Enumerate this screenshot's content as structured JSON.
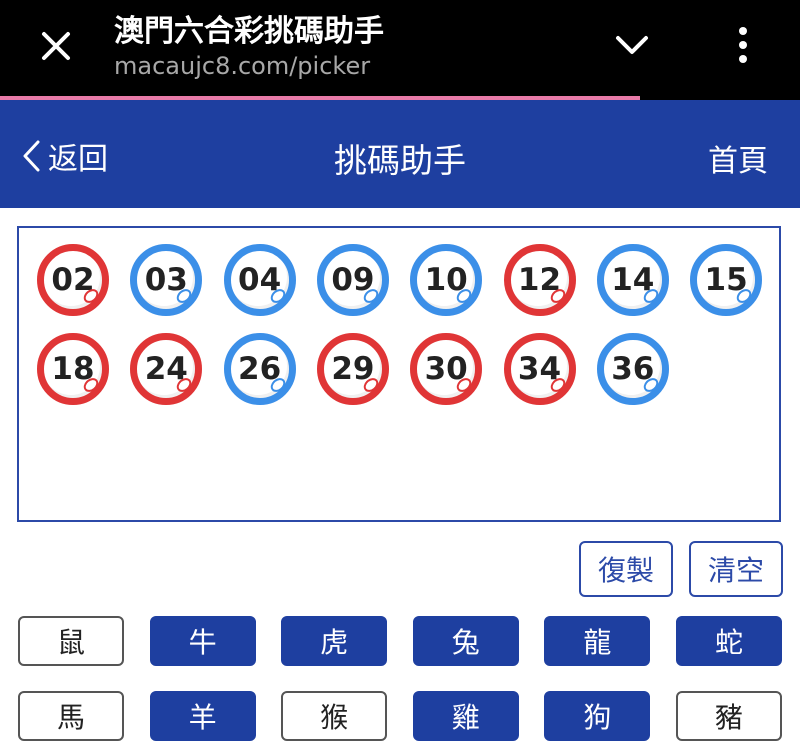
{
  "browser": {
    "title": "澳門六合彩挑碼助手",
    "url": "macaujc8.com/picker",
    "load_progress": 0.8
  },
  "header": {
    "back_label": "返回",
    "title": "挑碼助手",
    "home_label": "首頁"
  },
  "numbers": [
    {
      "value": "02",
      "color": "red"
    },
    {
      "value": "03",
      "color": "blue"
    },
    {
      "value": "04",
      "color": "blue"
    },
    {
      "value": "09",
      "color": "blue"
    },
    {
      "value": "10",
      "color": "blue"
    },
    {
      "value": "12",
      "color": "red"
    },
    {
      "value": "14",
      "color": "blue"
    },
    {
      "value": "15",
      "color": "blue"
    },
    {
      "value": "18",
      "color": "red"
    },
    {
      "value": "24",
      "color": "red"
    },
    {
      "value": "26",
      "color": "blue"
    },
    {
      "value": "29",
      "color": "red"
    },
    {
      "value": "30",
      "color": "red"
    },
    {
      "value": "34",
      "color": "red"
    },
    {
      "value": "36",
      "color": "blue"
    }
  ],
  "actions": {
    "copy_label": "復製",
    "clear_label": "清空"
  },
  "zodiac": [
    {
      "label": "鼠",
      "selected": false
    },
    {
      "label": "牛",
      "selected": true
    },
    {
      "label": "虎",
      "selected": true
    },
    {
      "label": "兔",
      "selected": true
    },
    {
      "label": "龍",
      "selected": true
    },
    {
      "label": "蛇",
      "selected": true
    },
    {
      "label": "馬",
      "selected": false
    },
    {
      "label": "羊",
      "selected": true
    },
    {
      "label": "猴",
      "selected": false
    },
    {
      "label": "雞",
      "selected": true
    },
    {
      "label": "狗",
      "selected": true
    },
    {
      "label": "豬",
      "selected": false
    }
  ],
  "colors": {
    "brand_blue": "#1e3fa0",
    "ball_red": "#e03536",
    "ball_blue": "#3b8fe8",
    "progress": "#e77aa8"
  }
}
